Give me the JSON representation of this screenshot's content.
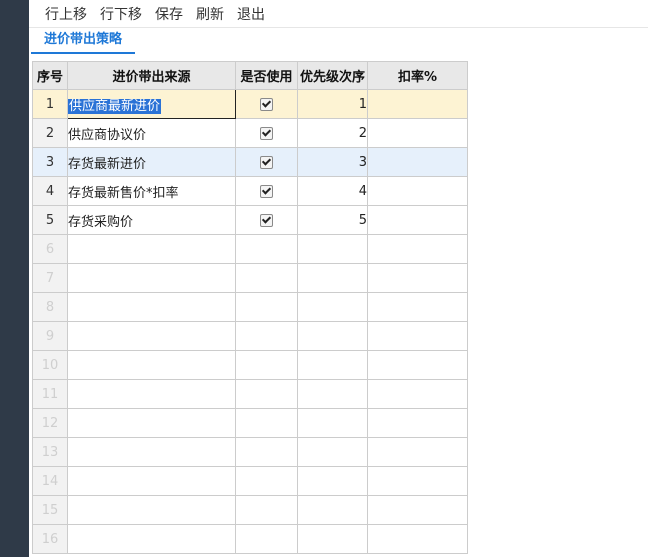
{
  "toolbar": {
    "buttons": [
      "行上移",
      "行下移",
      "保存",
      "刷新",
      "退出"
    ]
  },
  "tab": {
    "label": "进价带出策略"
  },
  "grid": {
    "headers": [
      "序号",
      "进价带出来源",
      "是否使用",
      "优先级次序",
      "扣率%"
    ],
    "rows": [
      {
        "seq": "1",
        "source": "供应商最新进价",
        "used": true,
        "priority": "1",
        "rate": ""
      },
      {
        "seq": "2",
        "source": "供应商协议价",
        "used": true,
        "priority": "2",
        "rate": ""
      },
      {
        "seq": "3",
        "source": "存货最新进价",
        "used": true,
        "priority": "3",
        "rate": ""
      },
      {
        "seq": "4",
        "source": "存货最新售价*扣率",
        "used": true,
        "priority": "4",
        "rate": ""
      },
      {
        "seq": "5",
        "source": "存货采购价",
        "used": true,
        "priority": "5",
        "rate": ""
      }
    ],
    "empty_row_numbers": [
      "6",
      "7",
      "8",
      "9",
      "10",
      "11",
      "12",
      "13",
      "14",
      "15",
      "16"
    ]
  },
  "colors": {
    "accent": "#1e78d7",
    "sidebar": "#2f3a48",
    "selected_row": "#fdf3d3",
    "hover_row": "#e6f0fb",
    "selection_highlight": "#2a72d6"
  }
}
